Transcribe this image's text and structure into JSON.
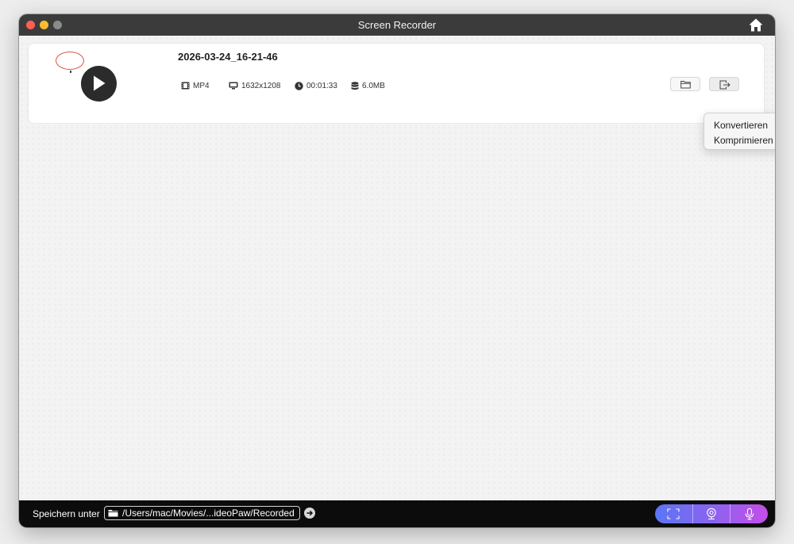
{
  "window": {
    "title": "Screen Recorder"
  },
  "recording": {
    "file_name": "2026-03-24_16-21-46",
    "format": "MP4",
    "resolution": "1632x1208",
    "duration": "00:01:33",
    "size": "6.0MB"
  },
  "export_menu": {
    "items": [
      "Konvertieren",
      "Komprimieren"
    ]
  },
  "bottom_bar": {
    "save_label": "Speichern unter",
    "save_path": "/Users/mac/Movies/...ideoPaw/Recorded"
  },
  "icons": {
    "home": "home-icon",
    "play": "play-icon",
    "format": "film-icon",
    "resolution": "monitor-icon",
    "duration": "clock-icon",
    "size": "database-icon",
    "open_folder": "folder-icon",
    "export": "export-icon",
    "go": "arrow-right-icon",
    "screen_mode": "screen-capture-icon",
    "webcam_mode": "webcam-icon",
    "audio_mode": "microphone-icon"
  },
  "colors": {
    "titlebar": "#3b3b3b",
    "bottombar": "#0c0c0c",
    "mode_gradient_start": "#5a76f6",
    "mode_gradient_end": "#c54ee8"
  }
}
